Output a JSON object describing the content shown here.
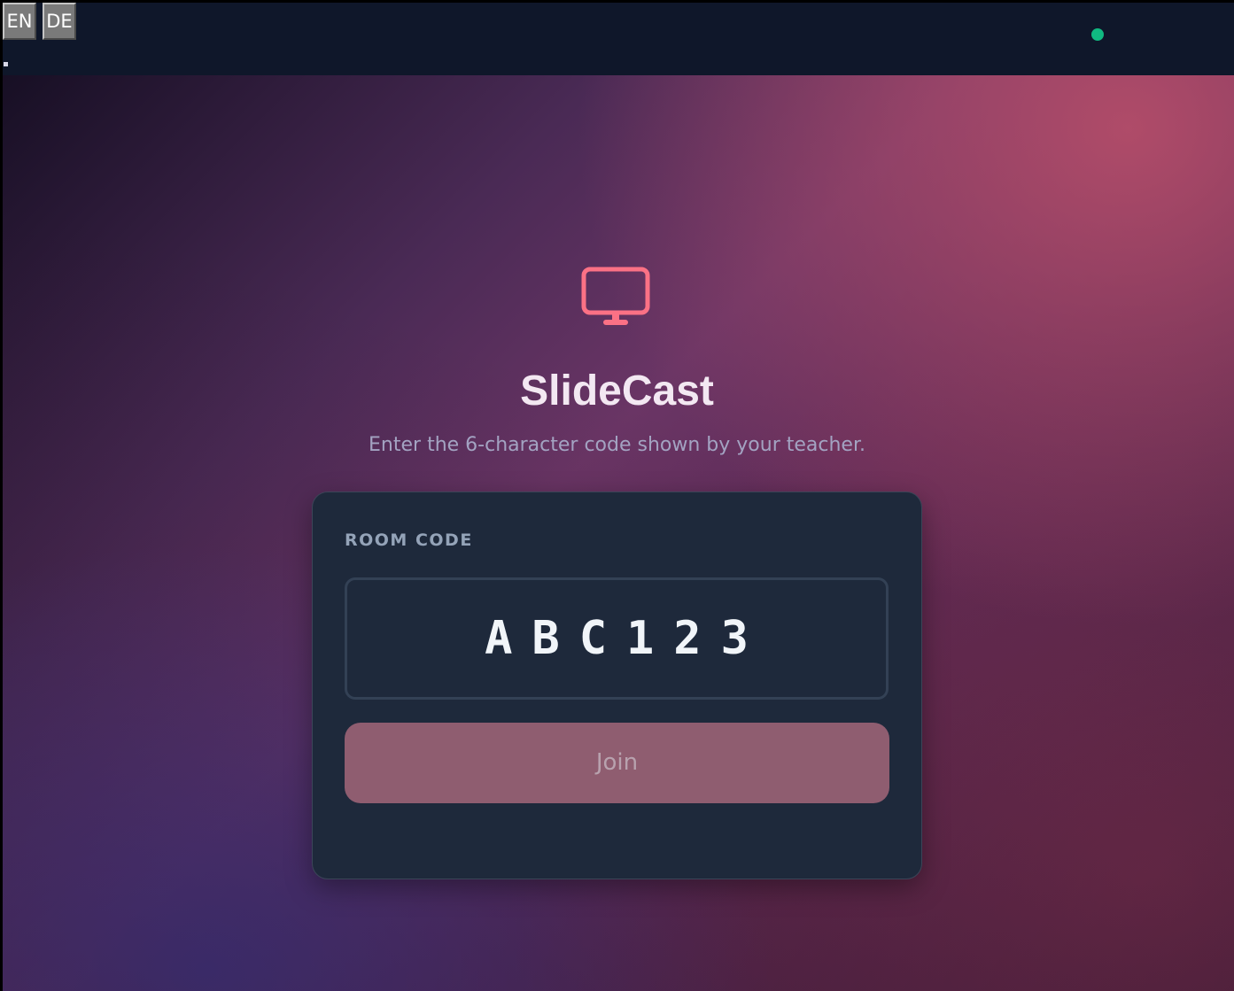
{
  "topbar": {
    "languages": [
      "EN",
      "DE"
    ],
    "status_color": "#10b981",
    "background": "#0f172a"
  },
  "hero": {
    "icon": "monitor-icon",
    "icon_color": "#fb7185",
    "title": "SlideCast",
    "subtitle": "Enter the 6-character code shown by your teacher."
  },
  "join_form": {
    "label": "ROOM CODE",
    "code_value": "ABC123",
    "join_label": "Join",
    "join_color": "#8f5d70"
  }
}
